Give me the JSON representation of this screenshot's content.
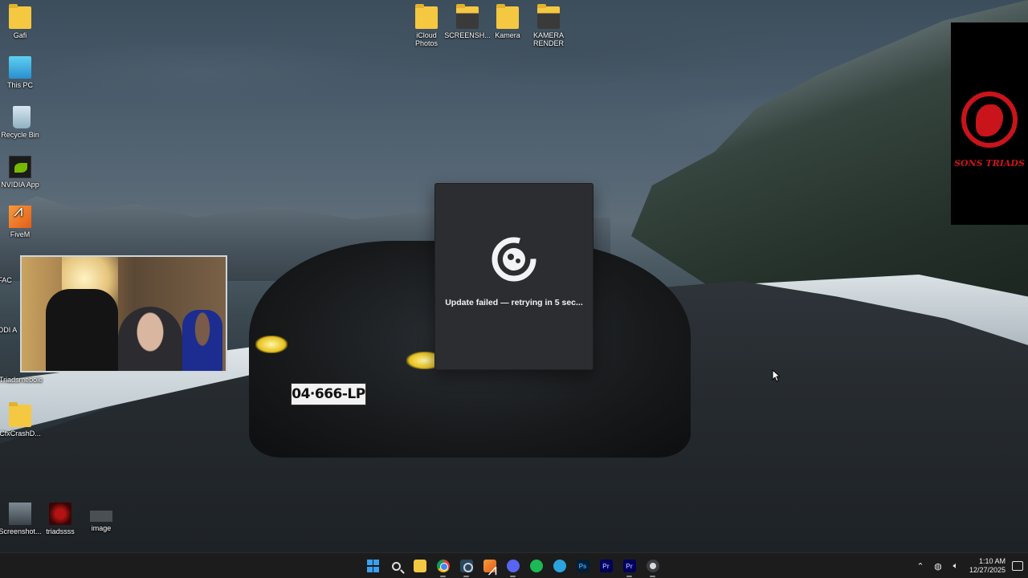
{
  "desktop": {
    "left_icons": [
      {
        "label": "Gafi",
        "icon": "folder-icon"
      },
      {
        "label": "This PC",
        "icon": "computer-icon"
      },
      {
        "label": "Recycle Bin",
        "icon": "recycle-bin-icon"
      },
      {
        "label": "NVIDIA App",
        "icon": "nvidia-icon"
      },
      {
        "label": "FiveM",
        "icon": "fivem-icon"
      },
      {
        "label": "FAC",
        "icon": "app-icon"
      },
      {
        "label": "RODI A",
        "icon": "app-icon"
      },
      {
        "label": "Triadsmebole",
        "icon": "app-icon"
      },
      {
        "label": "CfxCrashD...",
        "icon": "folder-icon"
      }
    ],
    "top_icons": [
      {
        "label": "iCloud Photos",
        "icon": "folder-icon"
      },
      {
        "label": "SCREENSH...",
        "icon": "folder-icon"
      },
      {
        "label": "Kamera",
        "icon": "folder-icon"
      },
      {
        "label": "KAMERA RENDER",
        "icon": "folder-icon"
      }
    ],
    "bottom_icons": [
      {
        "label": "Screenshot...",
        "icon": "screenshot-file-icon"
      },
      {
        "label": "triadssss",
        "icon": "image-file-icon"
      },
      {
        "label": "image",
        "icon": "image-file-icon"
      }
    ],
    "wallpaper_plate": "04·666-LP"
  },
  "side_logo": {
    "text": "SONS TRIADS"
  },
  "dialog": {
    "message": "Update failed — retrying in 5 sec...",
    "icon": "fivem-logo-icon"
  },
  "taskbar": {
    "apps": [
      "start",
      "search",
      "file-explorer",
      "chrome",
      "steam",
      "fivem",
      "discord",
      "spotify",
      "telegram",
      "photoshop",
      "premiere-pro",
      "premiere-pro",
      "fivem-launcher"
    ],
    "ps_label": "Ps",
    "pr_label": "Pr",
    "pr_label_2": "Pr",
    "time": "1:10 AM",
    "date": "12/27/2025"
  },
  "colors": {
    "dialog_bg": "#2b2d31",
    "taskbar_bg": "#1c1c1c",
    "accent_red": "#c8141a"
  }
}
